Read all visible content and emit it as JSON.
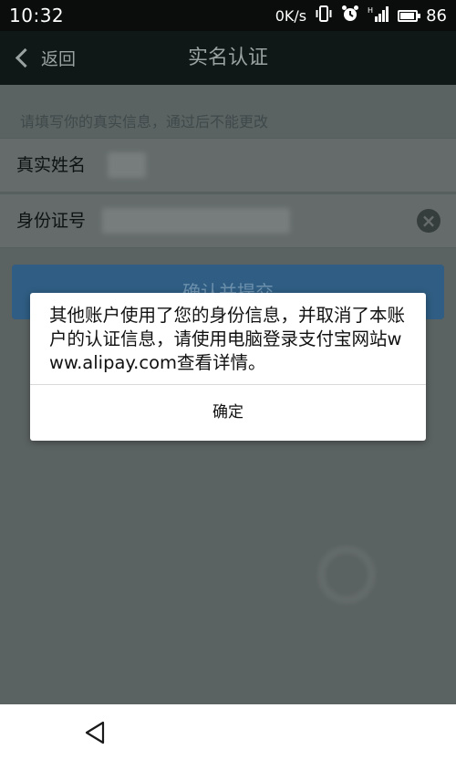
{
  "status_bar": {
    "time": "10:32",
    "net_speed": "0K/s",
    "icons": [
      "vibrate-icon",
      "alarm-icon",
      "signal-icon",
      "battery-icon"
    ],
    "battery_level": "86"
  },
  "header": {
    "back_label": "返回",
    "title": "实名认证"
  },
  "form": {
    "hint": "请填写你的真实信息，通过后不能更改",
    "name_label": "真实姓名",
    "id_label": "身份证号",
    "submit_label": "确认并提交"
  },
  "dialog": {
    "message": "其他账户使用了您的身份信息，并取消了本账户的认证信息，请使用电脑登录支付宝网站www.alipay.com查看详情。",
    "ok_label": "确定"
  },
  "colors": {
    "dialog_background": "#ffffff",
    "submit_button": "#2f5d83",
    "status_bar": "#0b0d0d"
  }
}
